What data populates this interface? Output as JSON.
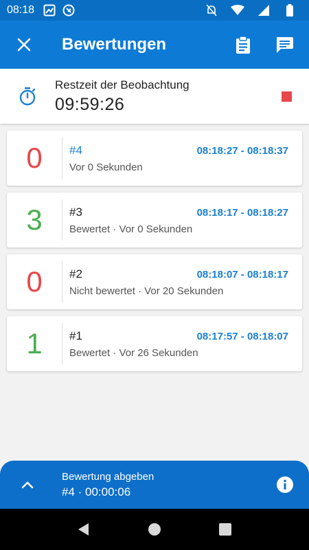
{
  "status_bar": {
    "time": "08:18"
  },
  "app_bar": {
    "title": "Bewertungen"
  },
  "timer": {
    "label": "Restzeit der Beobachtung",
    "value": "09:59:26"
  },
  "colors": {
    "primary": "#0d7bd6",
    "red": "#e8474b",
    "green": "#4caf50",
    "blue_text": "#1a7fd2"
  },
  "ratings": [
    {
      "score": "0",
      "score_color": "red",
      "number": "#4",
      "active": true,
      "range": "08:18:27 - 08:18:37",
      "subtitle": "Vor 0 Sekunden"
    },
    {
      "score": "3",
      "score_color": "green",
      "number": "#3",
      "active": false,
      "range": "08:18:17 - 08:18:27",
      "subtitle": "Bewertet · Vor 0 Sekunden"
    },
    {
      "score": "0",
      "score_color": "red",
      "number": "#2",
      "active": false,
      "range": "08:18:07 - 08:18:17",
      "subtitle": "Nicht bewertet · Vor 20 Sekunden"
    },
    {
      "score": "1",
      "score_color": "green",
      "number": "#1",
      "active": false,
      "range": "08:17:57 - 08:18:07",
      "subtitle": "Bewertet · Vor 26 Sekunden"
    }
  ],
  "bottom_panel": {
    "label": "Bewertung abgeben",
    "value": "#4 · 00:00:06"
  }
}
